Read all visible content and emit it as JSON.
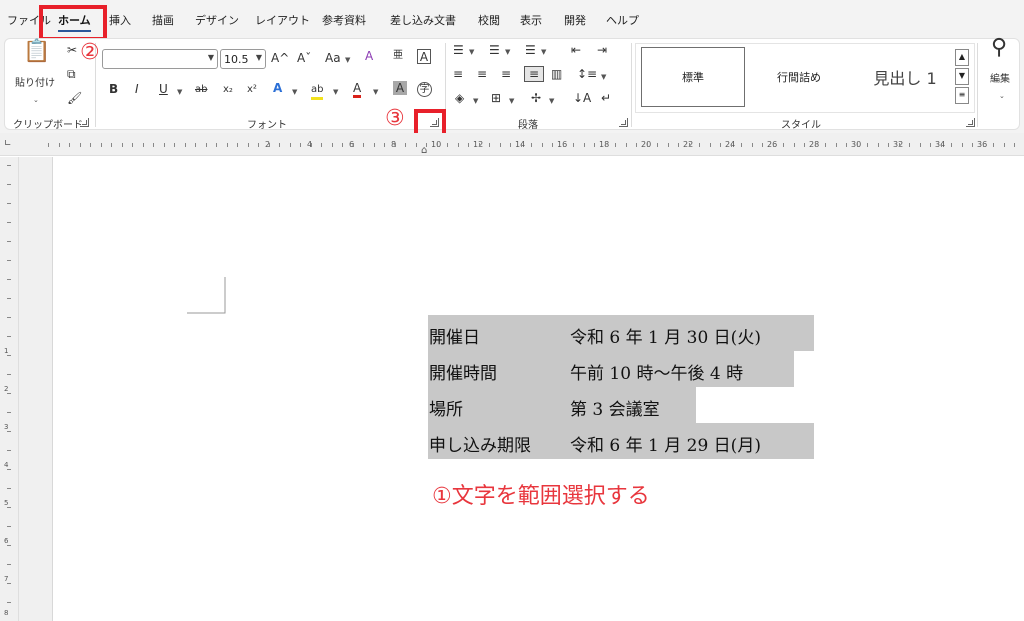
{
  "tabs": [
    "ファイル",
    "ホーム",
    "挿入",
    "描画",
    "デザイン",
    "レイアウト",
    "参考資料",
    "差し込み文書",
    "校閲",
    "表示",
    "開発",
    "ヘルプ"
  ],
  "clipboard": {
    "paste_label": "貼り付け",
    "group_label": "クリップボード"
  },
  "font": {
    "font_name": "",
    "font_size": "10.5",
    "grow": "A^",
    "shrink": "Aˇ",
    "case": "Aa",
    "clear": "A",
    "furigana": "亜",
    "border_char": "A",
    "bold": "B",
    "italic": "I",
    "underline": "U",
    "strike": "ab",
    "subscript": "x₂",
    "superscript": "x²",
    "effects": "A",
    "highlight": "ab",
    "color": "A",
    "shading": "A",
    "enclose": "字",
    "group_label": "フォント"
  },
  "paragraph": {
    "group_label": "段落"
  },
  "styles": {
    "items": [
      "標準",
      "行間詰め",
      "見出し 1"
    ],
    "group_label": "スタイル"
  },
  "editing": {
    "label": "編集"
  },
  "ruler": {
    "numbers": [
      "2",
      "4",
      "6",
      "8",
      "10",
      "12",
      "14",
      "16",
      "18",
      "20",
      "22",
      "24",
      "26",
      "28",
      "30",
      "32",
      "34",
      "36"
    ],
    "vnumbers": [
      "1",
      "2",
      "3",
      "4",
      "5",
      "6",
      "7",
      "8"
    ]
  },
  "document": {
    "rows": [
      {
        "label": "開催日",
        "value": "令和 6 年 1 月 30 日(火)"
      },
      {
        "label": "開催時間",
        "value": "午前 10 時～午後 4 時"
      },
      {
        "label": "場所",
        "value": "第 3 会議室"
      },
      {
        "label": "申し込み期限",
        "value": "令和 6 年 1 月 29 日(月)"
      }
    ]
  },
  "annotations": {
    "step1": "①文字を範囲選択する",
    "step2": "②",
    "step3": "③",
    "color": "#e8363d"
  }
}
